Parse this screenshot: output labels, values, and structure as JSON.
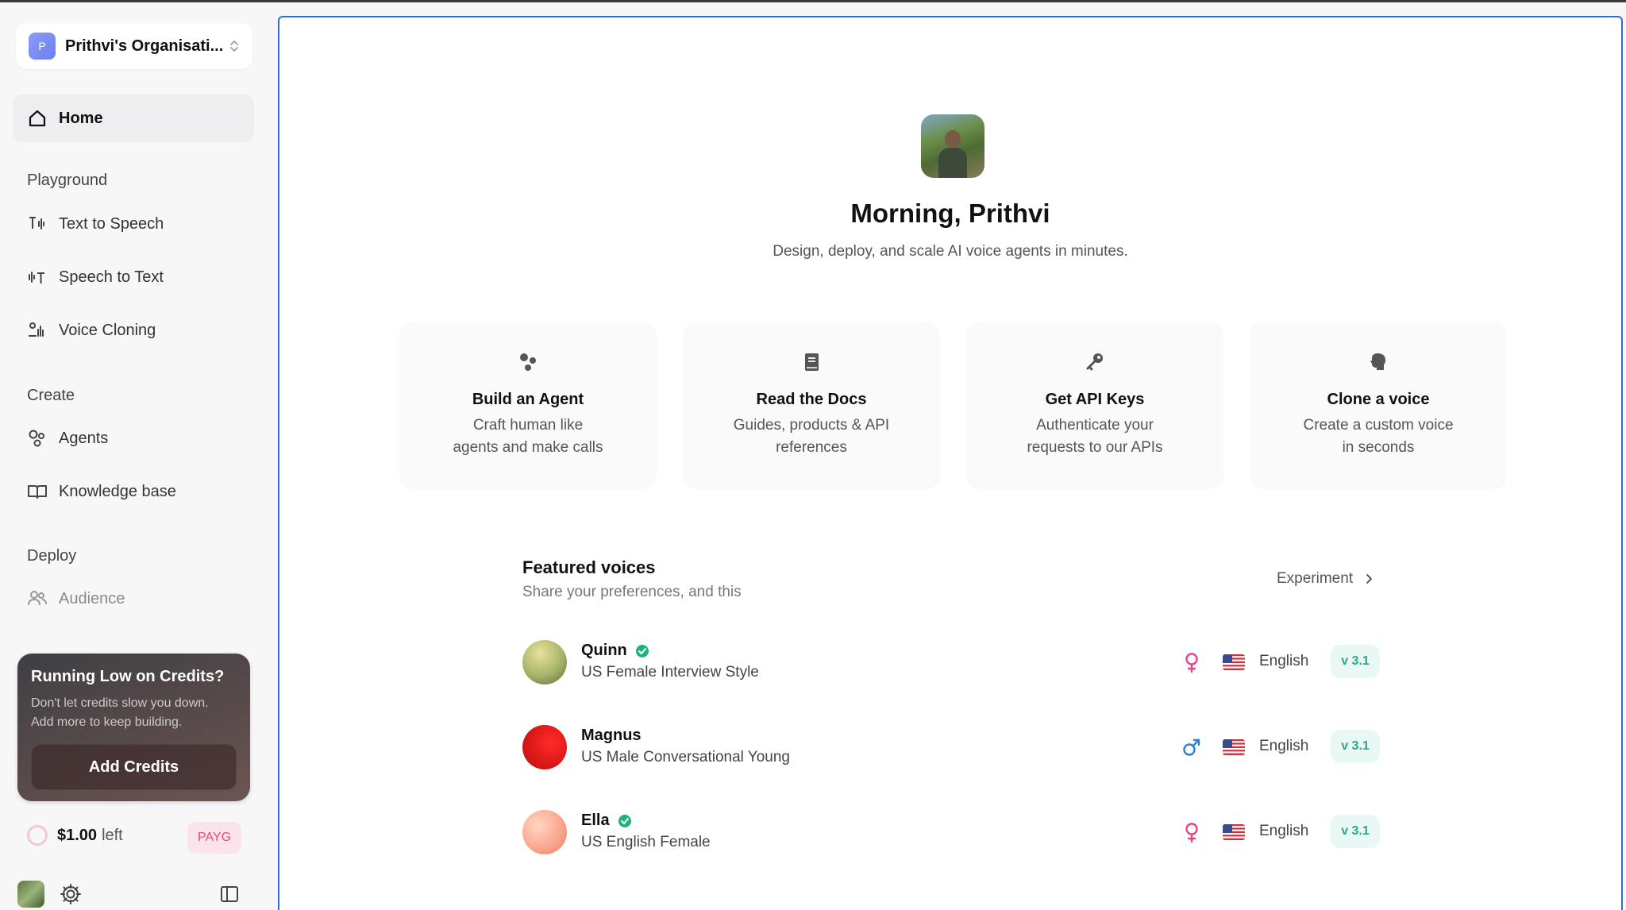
{
  "org": {
    "initial": "P",
    "name": "Prithvi's Organisati..."
  },
  "nav": {
    "home": "Home",
    "playground_title": "Playground",
    "playground": [
      "Text to Speech",
      "Speech to Text",
      "Voice Cloning"
    ],
    "create_title": "Create",
    "create": [
      "Agents",
      "Knowledge base"
    ],
    "deploy_title": "Deploy",
    "deploy": [
      "Audience"
    ]
  },
  "credits": {
    "title": "Running Low on Credits?",
    "line1": "Don't let credits slow you down.",
    "line2": "Add more to keep building.",
    "button": "Add Credits"
  },
  "balance": {
    "amount": "$1.00",
    "suffix": "left",
    "plan": "PAYG"
  },
  "hero": {
    "greeting": "Morning, Prithvi",
    "subtitle": "Design, deploy, and scale AI voice agents in minutes."
  },
  "cards": [
    {
      "icon": "agent-icon",
      "title": "Build an Agent",
      "line1": "Craft human like",
      "line2": "agents and make calls"
    },
    {
      "icon": "book-icon",
      "title": "Read the Docs",
      "line1": "Guides, products & API",
      "line2": "references"
    },
    {
      "icon": "key-icon",
      "title": "Get API Keys",
      "line1": "Authenticate your",
      "line2": "requests to our APIs"
    },
    {
      "icon": "head-icon",
      "title": "Clone a voice",
      "line1": "Create a custom voice",
      "line2": "in seconds"
    }
  ],
  "featured": {
    "title": "Featured voices",
    "subtitle": "Share your preferences, and this",
    "action": "Experiment"
  },
  "voices": [
    {
      "name": "Quinn",
      "verified": true,
      "desc": "US Female Interview Style",
      "gender": "female",
      "language": "English",
      "version": "v 3.1"
    },
    {
      "name": "Magnus",
      "verified": false,
      "desc": "US Male Conversational Young",
      "gender": "male",
      "language": "English",
      "version": "v 3.1"
    },
    {
      "name": "Ella",
      "verified": true,
      "desc": "US English Female",
      "gender": "female",
      "language": "English",
      "version": "v 3.1"
    }
  ],
  "colors": {
    "accent_border": "#2f6fd0",
    "payg_text": "#e84a7a",
    "version_text": "#2aa88a",
    "verified": "#1fb37a"
  }
}
